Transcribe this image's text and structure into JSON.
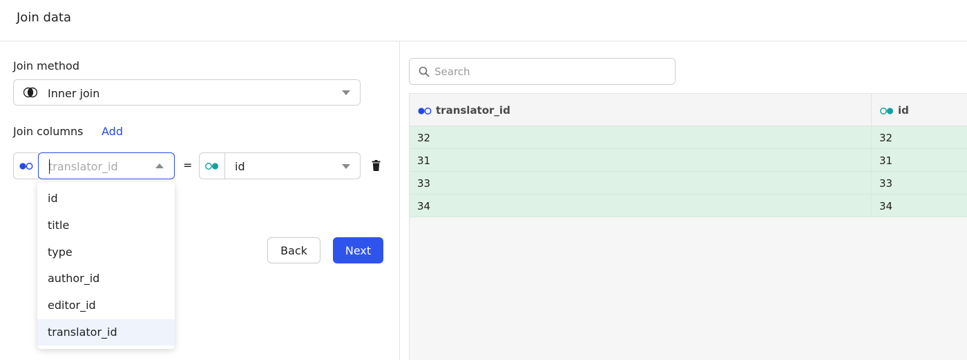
{
  "header": {
    "title": "Join data"
  },
  "join_method": {
    "label": "Join method",
    "value": "Inner join",
    "icon": "inner-join-icon"
  },
  "join_columns": {
    "label": "Join columns",
    "add_label": "Add",
    "left": {
      "placeholder": "translator_id",
      "icon": "left-table-icon"
    },
    "operator": "=",
    "right": {
      "value": "id",
      "icon": "right-table-icon"
    },
    "delete_icon": "trash-icon",
    "options": [
      "id",
      "title",
      "type",
      "author_id",
      "editor_id",
      "translator_id"
    ],
    "highlighted_option": "translator_id"
  },
  "buttons": {
    "back": "Back",
    "next": "Next"
  },
  "preview": {
    "search_placeholder": "Search",
    "columns": [
      {
        "name": "translator_id",
        "icon": "left-table-icon"
      },
      {
        "name": "id",
        "icon": "right-table-icon"
      }
    ],
    "rows": [
      [
        "32",
        "32"
      ],
      [
        "31",
        "31"
      ],
      [
        "33",
        "33"
      ],
      [
        "34",
        "34"
      ]
    ]
  },
  "colors": {
    "accent": "#2f54eb",
    "left_table": "#2549e6",
    "right_table": "#17a2a2",
    "match_row": "#dff2e6",
    "selected_option": "#eef3fc"
  }
}
